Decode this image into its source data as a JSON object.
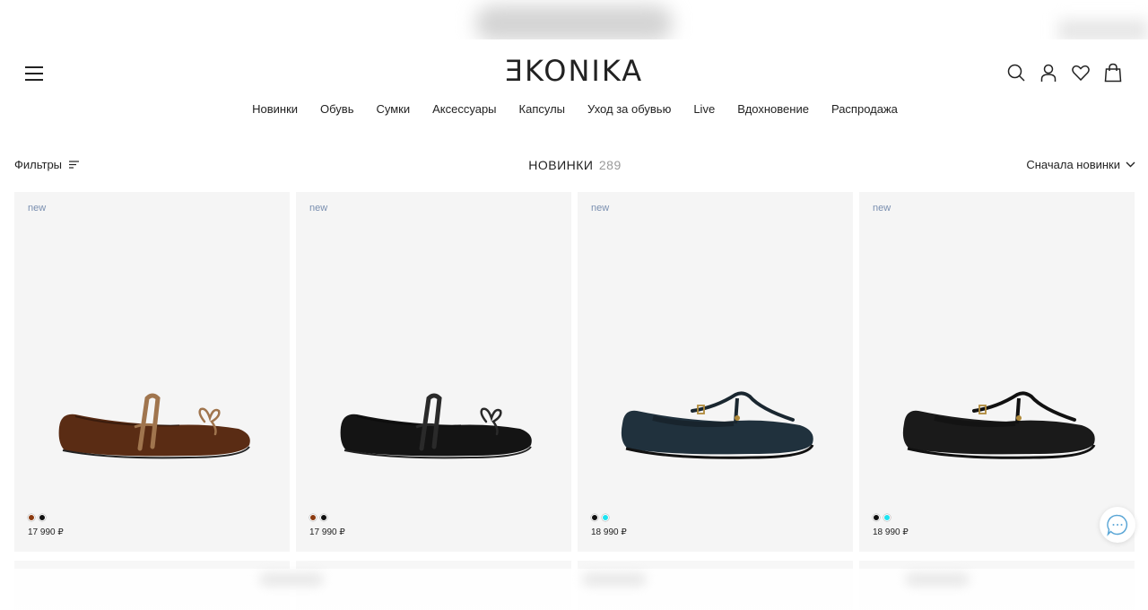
{
  "header": {
    "logo": "ƎKONIKA",
    "icons": [
      "search-icon",
      "account-icon",
      "heart-icon",
      "bag-icon"
    ]
  },
  "nav": [
    "Новинки",
    "Обувь",
    "Сумки",
    "Аксессуары",
    "Капсулы",
    "Уход за обувью",
    "Live",
    "Вдохновение",
    "Распродажа"
  ],
  "toolbar": {
    "filters_label": "Фильтры",
    "title": "НОВИНКИ",
    "count": "289",
    "sort_label": "Сначала новинки"
  },
  "products": [
    {
      "badge": "new",
      "price": "17 990 ₽",
      "colors": [
        "#8b3a10",
        "#111111"
      ],
      "style": "ballet",
      "shoe_color": "#5a2c14",
      "strap_color": "#a0754e"
    },
    {
      "badge": "new",
      "price": "17 990 ₽",
      "colors": [
        "#8b3a10",
        "#111111"
      ],
      "style": "ballet",
      "shoe_color": "#141414",
      "strap_color": "#2a2a2a"
    },
    {
      "badge": "new",
      "price": "18 990 ₽",
      "colors": [
        "#111111",
        "#1ee3f0"
      ],
      "style": "tstrap",
      "shoe_color": "#20313d",
      "strap_color": "#1a2730"
    },
    {
      "badge": "new",
      "price": "18 990 ₽",
      "colors": [
        "#111111",
        "#1ee3f0"
      ],
      "style": "tstrap",
      "shoe_color": "#1a1a1a",
      "strap_color": "#111111"
    }
  ],
  "chat": {
    "icon": "chat-bubble-icon"
  },
  "colors": {
    "badge": "#7a8fb0",
    "card_bg": "#f5f5f5",
    "count": "#9a9a9a"
  }
}
